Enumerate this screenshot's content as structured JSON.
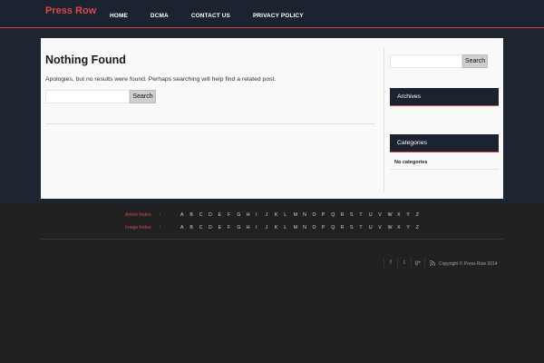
{
  "header": {
    "logo": "Press Row",
    "nav": [
      "HOME",
      "DCMA",
      "CONTACT US",
      "PRIVACY POLICY"
    ]
  },
  "main": {
    "title": "Nothing Found",
    "notice": "Apologies, but no results were found. Perhaps searching will help find a related post.",
    "search": {
      "value": "",
      "button_label": "Search"
    }
  },
  "sidebar": {
    "search": {
      "value": "",
      "button_label": "Search"
    },
    "widgets": [
      {
        "title": "Archives",
        "items": []
      },
      {
        "title": "Categories",
        "items": [
          "No categories"
        ]
      }
    ]
  },
  "footer": {
    "article_index_label": "Article Index",
    "image_index_label": "Image Index",
    "separator": ":",
    "letters": [
      "A",
      "B",
      "C",
      "D",
      "E",
      "F",
      "G",
      "H",
      "I",
      "J",
      "K",
      "L",
      "M",
      "N",
      "O",
      "P",
      "Q",
      "R",
      "S",
      "T",
      "U",
      "V",
      "W",
      "X",
      "Y",
      "Z"
    ],
    "social_icons": [
      "facebook-icon",
      "twitter-icon",
      "google-plus-icon",
      "rss-icon"
    ],
    "copyright": "Copyright © Press Row 2014"
  },
  "colors": {
    "accent": "#e0474f",
    "header_bg": "#1b2330",
    "page_bg": "#212121"
  }
}
